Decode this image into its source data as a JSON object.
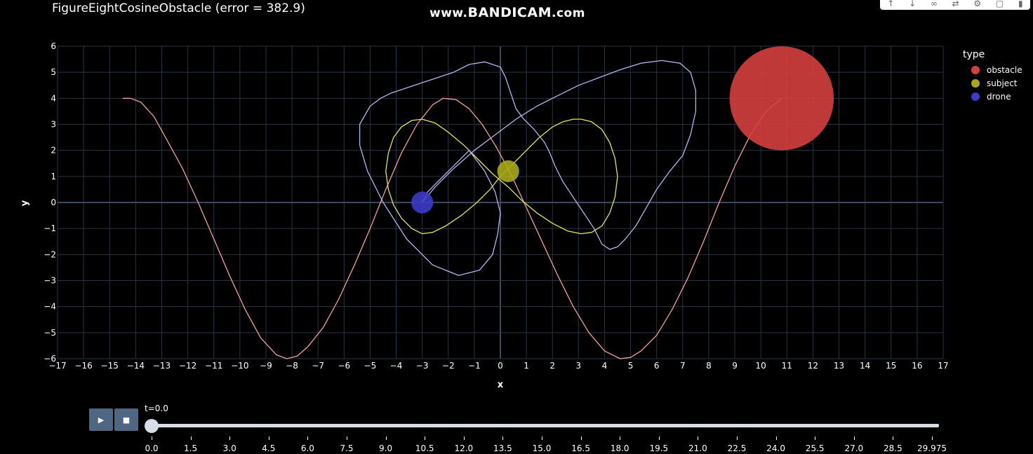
{
  "header": {
    "title": "FigureEightCosineObstacle (error = 382.9)",
    "watermark_prefix": "www.",
    "watermark_brand": "BANDICAM",
    "watermark_suffix": ".com"
  },
  "modebar": {
    "icons": [
      "arrow-up-icon",
      "arrow-down-icon",
      "link-icon",
      "compare-icon",
      "gear-icon",
      "document-icon",
      "trash-icon"
    ]
  },
  "chart_data": {
    "type": "scatter",
    "title": "FigureEightCosineObstacle (error = 382.9)",
    "xlabel": "x",
    "ylabel": "y",
    "xlim": [
      -17,
      17
    ],
    "ylim": [
      -6,
      6
    ],
    "x_ticks": [
      "−17",
      "−16",
      "−15",
      "−14",
      "−13",
      "−12",
      "−11",
      "−10",
      "−9",
      "−8",
      "−7",
      "−6",
      "−5",
      "−4",
      "−3",
      "−2",
      "−1",
      "0",
      "1",
      "2",
      "3",
      "4",
      "5",
      "6",
      "7",
      "8",
      "9",
      "10",
      "11",
      "12",
      "13",
      "14",
      "15",
      "16",
      "17"
    ],
    "y_ticks": [
      "6",
      "5",
      "4",
      "3",
      "2",
      "1",
      "0",
      "−1",
      "−2",
      "−3",
      "−4",
      "−5",
      "−6"
    ],
    "grid": true,
    "background": "#000000",
    "grid_color": "#283442",
    "legend": {
      "title": "type",
      "placement": "top-right",
      "items": [
        {
          "label": "obstacle",
          "color": "#d43f3f"
        },
        {
          "label": "subject",
          "color": "#a8a81a"
        },
        {
          "label": "drone",
          "color": "#3c3cc8"
        }
      ]
    },
    "series": [
      {
        "role": "obstacle-path",
        "color": "#f0a0a0",
        "x": [
          -14.5,
          -14.2,
          -13.8,
          -13.3,
          -12.8,
          -12.2,
          -11.6,
          -11.0,
          -10.4,
          -9.8,
          -9.2,
          -8.6,
          -8.2,
          -7.8,
          -7.4,
          -6.8,
          -6.2,
          -5.6,
          -5.0,
          -4.4,
          -3.8,
          -3.2,
          -2.6,
          -2.2,
          -1.7,
          -1.2,
          -0.7,
          -0.2,
          0.4,
          1.0,
          1.6,
          2.2,
          2.8,
          3.4,
          4.0,
          4.6,
          5.0,
          5.4,
          6.0,
          6.6,
          7.2,
          7.8,
          8.4,
          9.0,
          9.6,
          10.2,
          10.8
        ],
        "y": [
          4.0,
          4.0,
          3.85,
          3.3,
          2.4,
          1.3,
          0.0,
          -1.4,
          -2.8,
          -4.1,
          -5.2,
          -5.85,
          -6.0,
          -5.9,
          -5.55,
          -4.8,
          -3.7,
          -2.4,
          -1.0,
          0.5,
          1.9,
          3.0,
          3.75,
          4.0,
          3.95,
          3.6,
          3.0,
          2.2,
          1.1,
          -0.2,
          -1.5,
          -2.8,
          -4.0,
          -5.0,
          -5.7,
          -6.0,
          -5.95,
          -5.7,
          -5.1,
          -4.1,
          -2.9,
          -1.5,
          0.0,
          1.4,
          2.6,
          3.5,
          4.0
        ]
      },
      {
        "role": "subject-path",
        "color": "#e6e64a",
        "x": [
          0.0,
          0.5,
          1.0,
          1.5,
          2.0,
          2.4,
          2.8,
          3.1,
          3.5,
          3.9,
          4.2,
          4.4,
          4.5,
          4.4,
          4.2,
          3.9,
          3.5,
          3.1,
          2.6,
          2.0,
          1.4,
          0.8,
          0.3,
          -0.3,
          -0.8,
          -1.4,
          -2.0,
          -2.5,
          -3.0,
          -3.4,
          -3.8,
          -4.1,
          -4.3,
          -4.4,
          -4.3,
          -4.1,
          -3.8,
          -3.4,
          -3.0,
          -2.6,
          -2.1,
          -1.5,
          -0.9,
          -0.4,
          0.0
        ],
        "y": [
          1.0,
          1.5,
          2.0,
          2.5,
          2.9,
          3.1,
          3.2,
          3.2,
          3.1,
          2.8,
          2.3,
          1.7,
          1.0,
          0.2,
          -0.4,
          -0.9,
          -1.15,
          -1.2,
          -1.1,
          -0.8,
          -0.4,
          0.1,
          0.6,
          1.1,
          1.6,
          2.2,
          2.7,
          3.05,
          3.2,
          3.15,
          2.9,
          2.5,
          1.9,
          1.2,
          0.5,
          -0.1,
          -0.6,
          -1.0,
          -1.2,
          -1.15,
          -0.9,
          -0.5,
          0.0,
          0.5,
          1.0
        ]
      },
      {
        "role": "drone-path",
        "color": "#b4b4f0",
        "x": [
          -3.0,
          -2.5,
          -1.8,
          -1.0,
          -0.2,
          0.6,
          1.4,
          2.2,
          3.0,
          3.8,
          4.6,
          5.4,
          6.2,
          6.9,
          7.3,
          7.5,
          7.5,
          7.3,
          7.0,
          6.5,
          6.0,
          5.6,
          5.2,
          4.8,
          4.5,
          4.2,
          3.9,
          3.6,
          3.2,
          2.8,
          2.4,
          2.1,
          1.9,
          1.7,
          1.3,
          0.9,
          0.6,
          0.4,
          0.2,
          0.0,
          -0.6,
          -1.2,
          -1.8,
          -2.4,
          -3.0,
          -3.6,
          -4.2,
          -4.6,
          -5.0,
          -5.4,
          -5.4,
          -5.1,
          -4.5,
          -3.6,
          -2.6,
          -1.6,
          -0.8,
          -0.3,
          -0.1,
          0.0,
          -0.2,
          -0.6,
          -1.2,
          -2.0,
          -2.8,
          -3.0
        ],
        "y": [
          0.0,
          0.6,
          1.3,
          2.0,
          2.6,
          3.2,
          3.7,
          4.1,
          4.5,
          4.8,
          5.1,
          5.35,
          5.45,
          5.35,
          5.0,
          4.3,
          3.5,
          2.6,
          1.8,
          1.2,
          0.5,
          -0.2,
          -0.9,
          -1.4,
          -1.7,
          -1.8,
          -1.6,
          -1.0,
          -0.4,
          0.2,
          0.8,
          1.4,
          1.9,
          2.3,
          2.8,
          3.2,
          3.6,
          4.2,
          4.8,
          5.2,
          5.4,
          5.3,
          5.0,
          4.8,
          4.6,
          4.4,
          4.2,
          4.0,
          3.7,
          3.0,
          2.2,
          1.2,
          0.0,
          -1.4,
          -2.4,
          -2.8,
          -2.6,
          -2.0,
          -1.2,
          -0.4,
          0.4,
          1.2,
          2.0,
          1.2,
          0.4,
          0.0
        ]
      }
    ],
    "markers": [
      {
        "label": "obstacle",
        "x": 10.8,
        "y": 4.0,
        "radius": 2.0,
        "color": "#d43f3f"
      },
      {
        "label": "subject",
        "x": 0.3,
        "y": 1.2,
        "radius": 0.42,
        "color": "#a8a81a"
      },
      {
        "label": "drone",
        "x": -3.0,
        "y": 0.0,
        "radius": 0.42,
        "color": "#3c3cc8"
      }
    ]
  },
  "controls": {
    "play_label": "▶",
    "stop_label": "■",
    "slider_current": "t=0.0",
    "slider_value": 0.0,
    "slider_ticks": [
      "0.0",
      "1.5",
      "3.0",
      "4.5",
      "6.0",
      "7.5",
      "9.0",
      "10.5",
      "12.0",
      "13.5",
      "15.0",
      "16.5",
      "18.0",
      "19.5",
      "21.0",
      "22.5",
      "24.0",
      "25.5",
      "27.0",
      "28.5",
      "29.975"
    ]
  }
}
